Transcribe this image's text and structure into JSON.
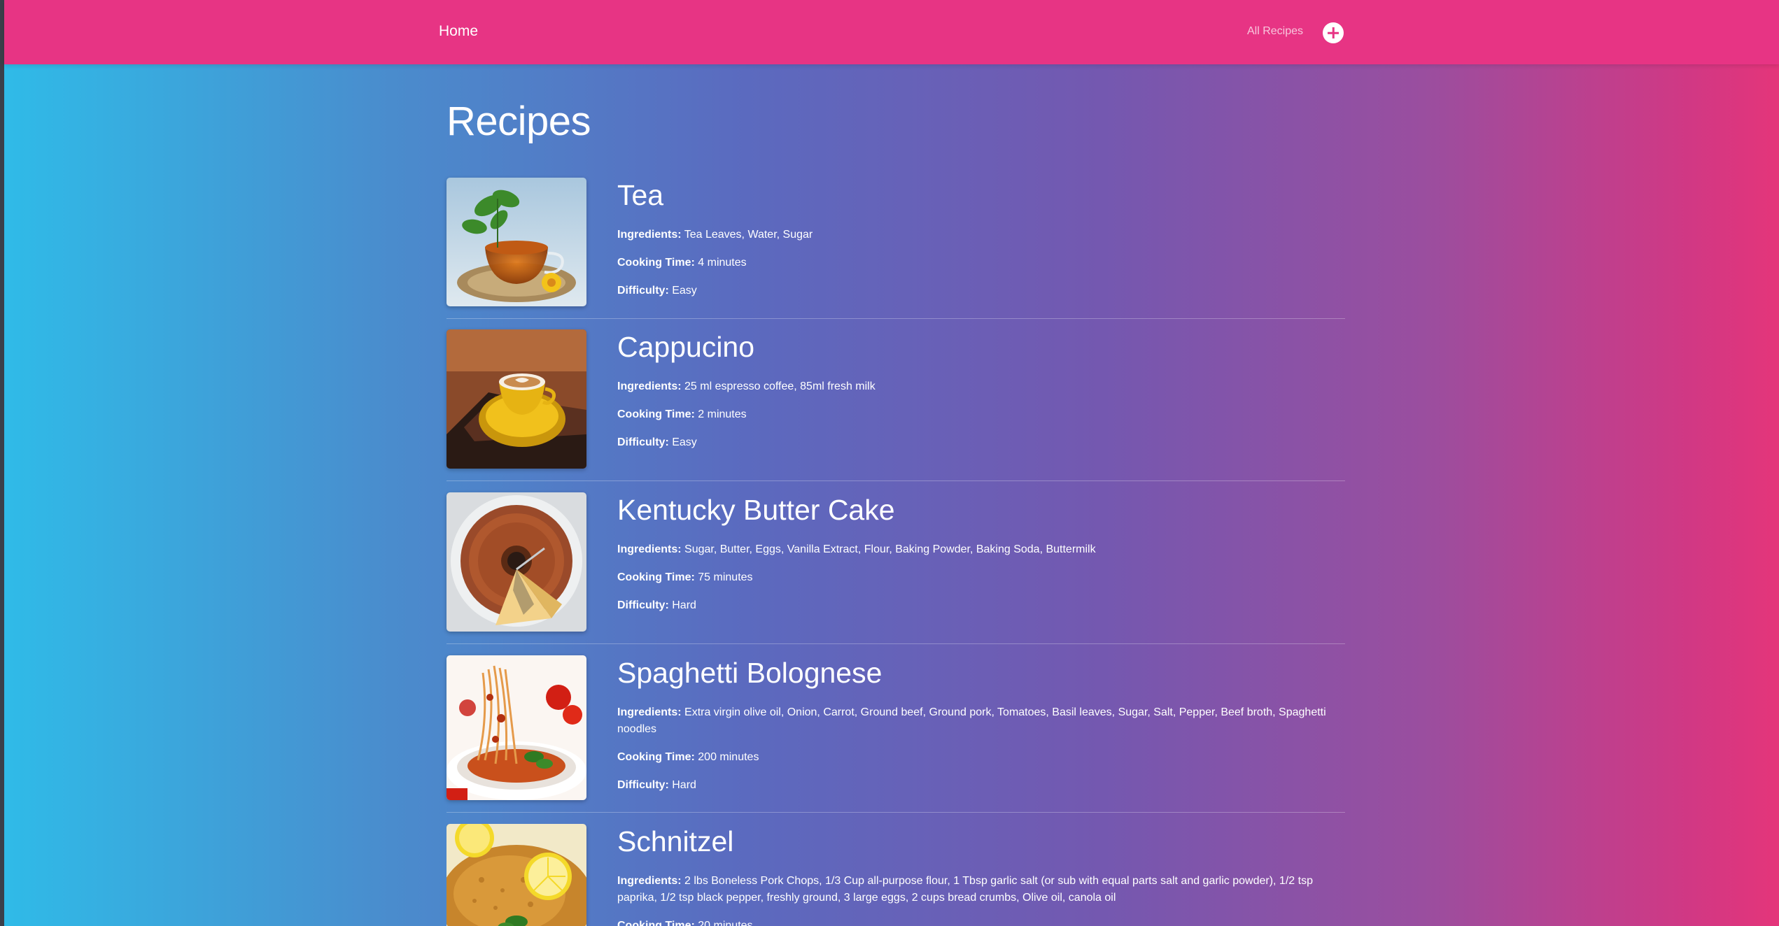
{
  "nav": {
    "home": "Home",
    "all_recipes": "All Recipes"
  },
  "page": {
    "title": "Recipes"
  },
  "labels": {
    "ingredients": "Ingredients:",
    "cooking_time": "Cooking Time:",
    "difficulty": "Difficulty:"
  },
  "recipes": [
    {
      "name": "Tea",
      "ingredients": "Tea Leaves, Water, Sugar",
      "cooking_time": "4 minutes",
      "difficulty": "Easy"
    },
    {
      "name": "Cappucino",
      "ingredients": "25 ml espresso coffee, 85ml fresh milk",
      "cooking_time": "2 minutes",
      "difficulty": "Easy"
    },
    {
      "name": "Kentucky Butter Cake",
      "ingredients": "Sugar, Butter, Eggs, Vanilla Extract, Flour, Baking Powder, Baking Soda, Buttermilk",
      "cooking_time": "75 minutes",
      "difficulty": "Hard"
    },
    {
      "name": "Spaghetti Bolognese",
      "ingredients": "Extra virgin olive oil, Onion, Carrot, Ground beef, Ground pork, Tomatoes, Basil leaves, Sugar, Salt, Pepper, Beef broth, Spaghetti noodles",
      "cooking_time": "200 minutes",
      "difficulty": "Hard"
    },
    {
      "name": "Schnitzel",
      "ingredients": "2 lbs Boneless Pork Chops, 1/3 Cup all-purpose flour, 1 Tbsp garlic salt (or sub with equal parts salt and garlic powder), 1/2 tsp paprika, 1/2 tsp black pepper, freshly ground, 3 large eggs, 2 cups bread crumbs, Olive oil, canola oil",
      "cooking_time": "20 minutes",
      "difficulty": ""
    }
  ],
  "colors": {
    "navbar": "#e73484",
    "gradient_left": "#2fbbe8",
    "gradient_right": "#e4357a"
  }
}
